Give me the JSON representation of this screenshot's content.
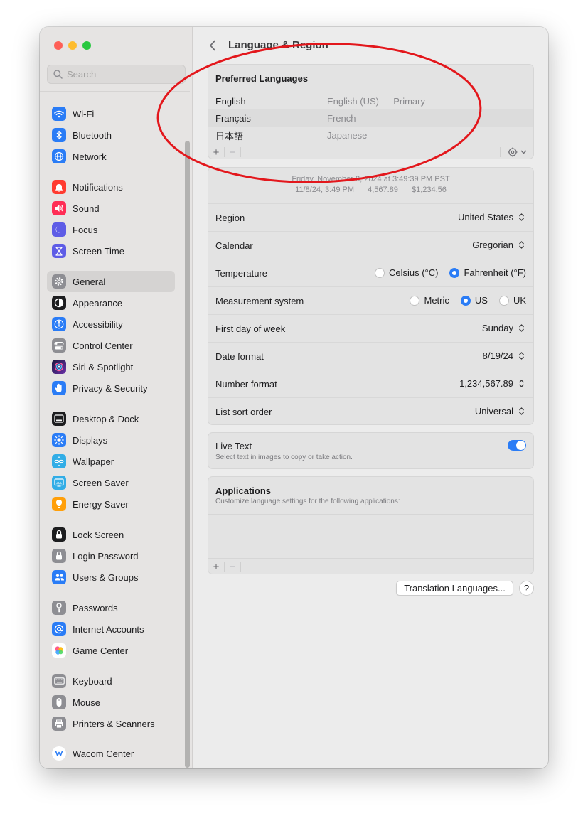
{
  "window": {
    "traffic_colors": [
      "#fe5f57",
      "#febc2e",
      "#28c840"
    ]
  },
  "sidebar": {
    "search_placeholder": "Search",
    "items": [
      {
        "label": "Wi-Fi",
        "icon": "wifi-icon",
        "color": "#2a7cf6"
      },
      {
        "label": "Bluetooth",
        "icon": "bluetooth-icon",
        "color": "#2a7cf6"
      },
      {
        "label": "Network",
        "icon": "globe-icon",
        "color": "#2a7cf6"
      },
      {
        "label": "Notifications",
        "icon": "bell-icon",
        "color": "#ff3b30"
      },
      {
        "label": "Sound",
        "icon": "speaker-icon",
        "color": "#ff2d55"
      },
      {
        "label": "Focus",
        "icon": "moon-icon",
        "color": "#5e5ce6"
      },
      {
        "label": "Screen Time",
        "icon": "hourglass-icon",
        "color": "#5e5ce6"
      },
      {
        "label": "General",
        "icon": "gear-icon",
        "color": "#8e8e93"
      },
      {
        "label": "Appearance",
        "icon": "appearance-icon",
        "color": "#1d1d1f"
      },
      {
        "label": "Accessibility",
        "icon": "accessibility-icon",
        "color": "#2a7cf6"
      },
      {
        "label": "Control Center",
        "icon": "toggles-icon",
        "color": "#8e8e93"
      },
      {
        "label": "Siri & Spotlight",
        "icon": "siri-icon",
        "color": "#b146c2"
      },
      {
        "label": "Privacy & Security",
        "icon": "hand-icon",
        "color": "#2a7cf6"
      },
      {
        "label": "Desktop & Dock",
        "icon": "dock-icon",
        "color": "#1d1d1f"
      },
      {
        "label": "Displays",
        "icon": "sun-icon",
        "color": "#2a7cf6"
      },
      {
        "label": "Wallpaper",
        "icon": "flower-icon",
        "color": "#32ade6"
      },
      {
        "label": "Screen Saver",
        "icon": "screensaver-icon",
        "color": "#32ade6"
      },
      {
        "label": "Energy Saver",
        "icon": "lightbulb-icon",
        "color": "#ff9f0a"
      },
      {
        "label": "Lock Screen",
        "icon": "lock-icon",
        "color": "#1d1d1f"
      },
      {
        "label": "Login Password",
        "icon": "lock-icon",
        "color": "#8e8e93"
      },
      {
        "label": "Users & Groups",
        "icon": "users-icon",
        "color": "#2a7cf6"
      },
      {
        "label": "Passwords",
        "icon": "key-icon",
        "color": "#8e8e93"
      },
      {
        "label": "Internet Accounts",
        "icon": "at-icon",
        "color": "#2a7cf6"
      },
      {
        "label": "Game Center",
        "icon": "game-center-icon",
        "color": "#ffffff"
      },
      {
        "label": "Keyboard",
        "icon": "keyboard-icon",
        "color": "#8e8e93"
      },
      {
        "label": "Mouse",
        "icon": "mouse-icon",
        "color": "#8e8e93"
      },
      {
        "label": "Printers & Scanners",
        "icon": "printer-icon",
        "color": "#8e8e93"
      },
      {
        "label": "Wacom Center",
        "icon": "wacom-icon",
        "color": "#ffffff"
      }
    ]
  },
  "header": {
    "title": "Language & Region"
  },
  "preferred": {
    "title": "Preferred Languages",
    "languages": [
      {
        "name": "English",
        "desc": "English (US) — Primary"
      },
      {
        "name": "Français",
        "desc": "French"
      },
      {
        "name": "日本語",
        "desc": "Japanese"
      }
    ]
  },
  "preview": {
    "line1": "Friday, November 8, 2024 at 3:49:39 PM PST",
    "line2": [
      "11/8/24, 3:49 PM",
      "4,567.89",
      "$1,234.56"
    ]
  },
  "settings": {
    "region": {
      "label": "Region",
      "value": "United States"
    },
    "calendar": {
      "label": "Calendar",
      "value": "Gregorian"
    },
    "temperature": {
      "label": "Temperature",
      "options": [
        "Celsius (°C)",
        "Fahrenheit (°F)"
      ],
      "selected": "Fahrenheit (°F)"
    },
    "measurement": {
      "label": "Measurement system",
      "options": [
        "Metric",
        "US",
        "UK"
      ],
      "selected": "US"
    },
    "first_day": {
      "label": "First day of week",
      "value": "Sunday"
    },
    "date_format": {
      "label": "Date format",
      "value": "8/19/24"
    },
    "number_format": {
      "label": "Number format",
      "value": "1,234,567.89"
    },
    "list_sort": {
      "label": "List sort order",
      "value": "Universal"
    }
  },
  "live_text": {
    "title": "Live Text",
    "subtitle": "Select text in images to copy or take action.",
    "enabled": true
  },
  "applications": {
    "title": "Applications",
    "subtitle": "Customize language settings for the following applications:"
  },
  "footer": {
    "translation_button": "Translation Languages...",
    "help": "?"
  },
  "colors": {
    "accent": "#2a7cf6",
    "annotation": "#e3171c"
  }
}
